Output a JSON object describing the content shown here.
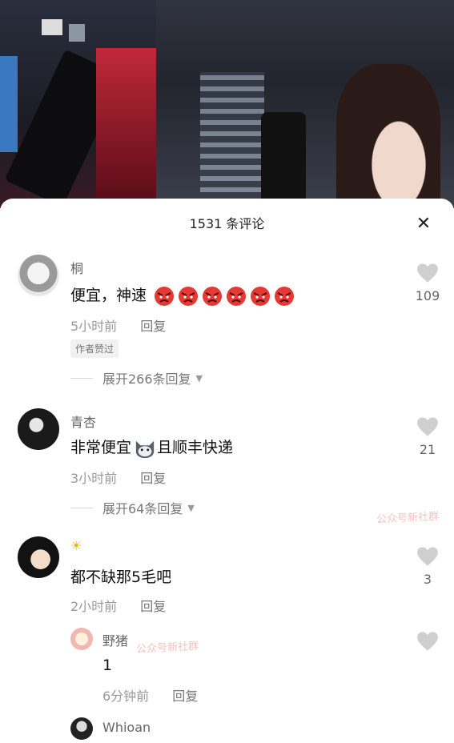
{
  "sheet": {
    "title": "1531 条评论",
    "close": "✕"
  },
  "comments": [
    {
      "user": "桐",
      "text": "便宜，神速",
      "emojis": [
        "angry",
        "angry",
        "angry",
        "angry",
        "angry",
        "angry"
      ],
      "time": "5小时前",
      "reply": "回复",
      "badge": "作者赞过",
      "expand": "展开266条回复",
      "likes": "109"
    },
    {
      "user": "青杏",
      "text_before": "非常便宜",
      "text_after": "且顺丰快递",
      "time": "3小时前",
      "reply": "回复",
      "expand": "展开64条回复",
      "likes": "21"
    },
    {
      "user": "☀",
      "text": "都不缺那5毛吧",
      "time": "2小时前",
      "reply": "回复",
      "likes": "3"
    }
  ],
  "subreply": {
    "user": "野猪",
    "text": "1",
    "time": "6分钟前",
    "reply": "回复"
  },
  "next": {
    "user": "Whioan"
  },
  "watermark": "公众号新社群",
  "colors": {
    "like_heart": "#cfcfcf",
    "angry_face": "#e53935"
  }
}
